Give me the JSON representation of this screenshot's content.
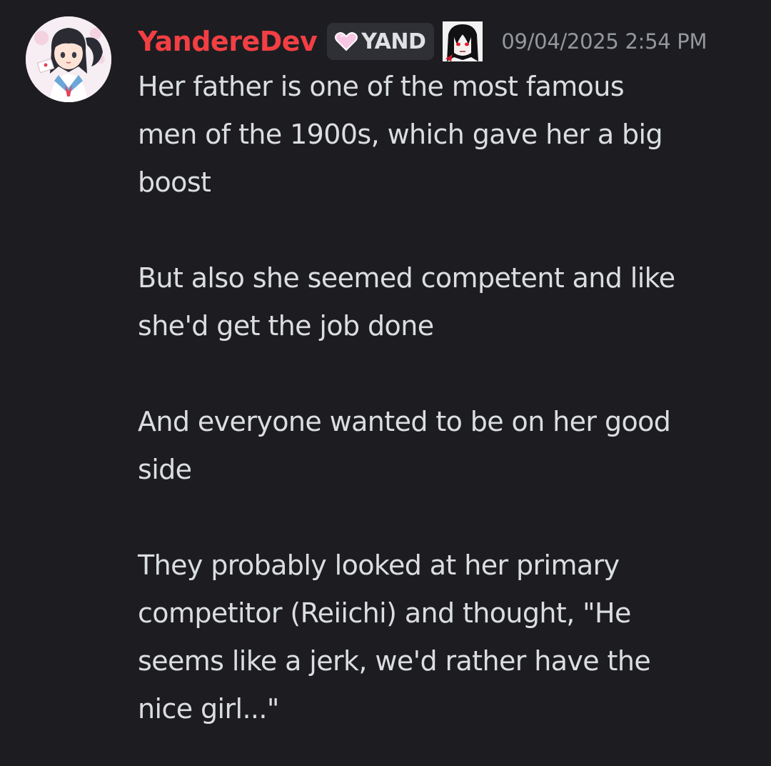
{
  "message": {
    "author": "YandereDev",
    "author_color": "#f23f43",
    "tag": {
      "icon": "pink-heart-icon",
      "label": "YAND"
    },
    "role_icon": "anime-character-role-icon",
    "timestamp": "09/04/2025 2:54 PM",
    "paragraphs": [
      [
        "Her father is one of the most famous",
        "men of the 1900s, which gave her a big",
        "boost"
      ],
      [
        "But also she seemed competent and like",
        "she'd get the job done"
      ],
      [
        "And everyone wanted to be on her good",
        "side"
      ],
      [
        "They probably looked at her primary",
        "competitor (Reiichi) and thought, \"He",
        "seems like a jerk, we'd rather have the",
        "nice girl...\""
      ]
    ]
  },
  "theme": {
    "background": "#1d1d21",
    "text": "#dbdee1",
    "timestamp": "#94979e",
    "tag_background": "#2f3035"
  }
}
